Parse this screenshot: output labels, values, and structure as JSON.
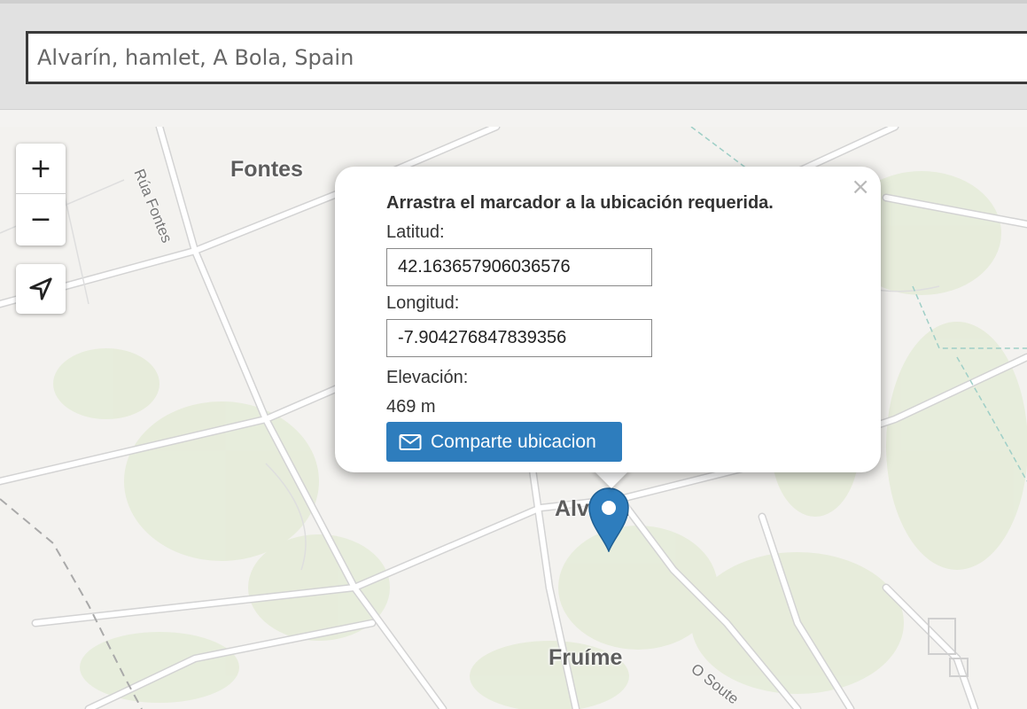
{
  "search": {
    "value": "Alvarín, hamlet, A Bola, Spain",
    "placeholder": ""
  },
  "map_labels": {
    "fontes": "Fontes",
    "alvarin": "Alvarín",
    "fruime": "Fruíme",
    "rua_fontes": "Rúa Fontes",
    "o_soute": "O Soute"
  },
  "controls": {
    "zoom_in": "+",
    "zoom_out": "−",
    "locate_icon": "navigation-arrow-icon"
  },
  "popup": {
    "close": "×",
    "title": "Arrastra el marcador a la ubicación requerida.",
    "latitude_label": "Latitud:",
    "latitude_value": "42.163657906036576",
    "longitude_label": "Longitud:",
    "longitude_value": "-7.904276847839356",
    "elevation_label": "Elevación:",
    "elevation_value": "469 m",
    "share_label": "Comparte ubicacion",
    "share_icon": "envelope-icon"
  },
  "colors": {
    "marker": "#2e7dbd",
    "button": "#2e7dbd",
    "road": "#ffffff",
    "vegetation": "#e6ecd9"
  }
}
